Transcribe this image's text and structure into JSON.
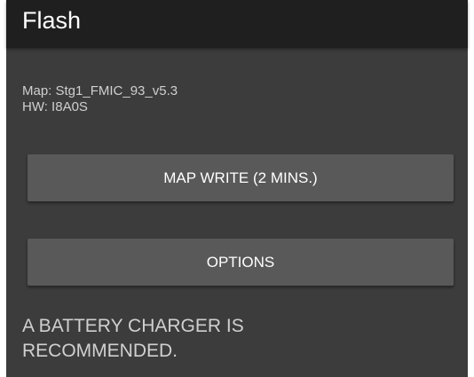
{
  "screen": {
    "title": "Flash"
  },
  "info": {
    "map_line": "Map: Stg1_FMIC_93_v5.3",
    "hw_line": "HW: I8A0S"
  },
  "buttons": {
    "map_write_label": "MAP WRITE (2 MINS.)",
    "options_label": "OPTIONS"
  },
  "notice": {
    "line1": "A BATTERY CHARGER IS",
    "line2": "RECOMMENDED."
  },
  "colors": {
    "background": "#3c3c3c",
    "titlebar": "#1f1f1f",
    "button": "#595959"
  }
}
